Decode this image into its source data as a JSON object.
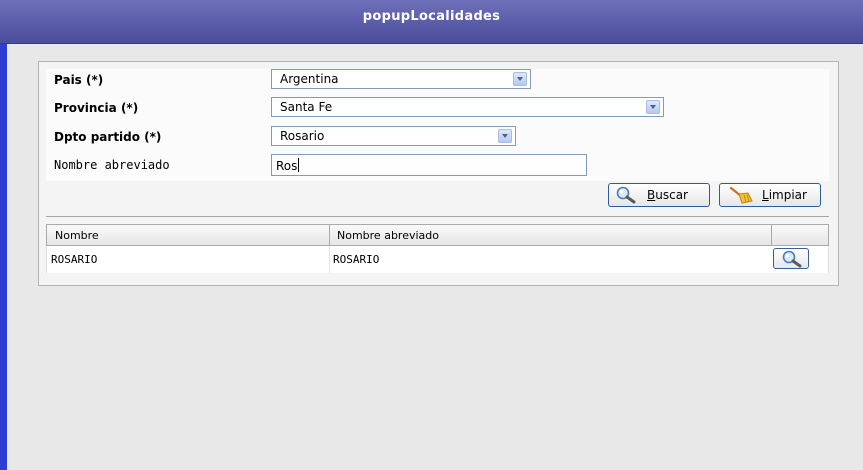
{
  "window": {
    "title": "popupLocalidades"
  },
  "form": {
    "pais": {
      "label": "Pais (*)",
      "value": "Argentina"
    },
    "provincia": {
      "label": "Provincia (*)",
      "value": "Santa Fe"
    },
    "dpto": {
      "label": "Dpto partido (*)",
      "value": "Rosario"
    },
    "nombre_abreviado": {
      "label": "Nombre abreviado",
      "value": "Ros"
    }
  },
  "buttons": {
    "buscar": {
      "accel": "B",
      "rest": "uscar"
    },
    "limpiar": {
      "accel": "L",
      "rest": "impiar"
    }
  },
  "table": {
    "columns": [
      "Nombre",
      "Nombre abreviado"
    ],
    "rows": [
      {
        "nombre": "ROSARIO",
        "nombre_abreviado": "ROSARIO"
      }
    ]
  },
  "icons": {
    "search": "magnifier-icon",
    "clear": "broom-icon",
    "dropdown": "chevron-down-icon"
  },
  "colors": {
    "titlebar": "#4b4c9c",
    "accent_strip": "#2b3fd1",
    "button_border": "#2f5b9c"
  }
}
